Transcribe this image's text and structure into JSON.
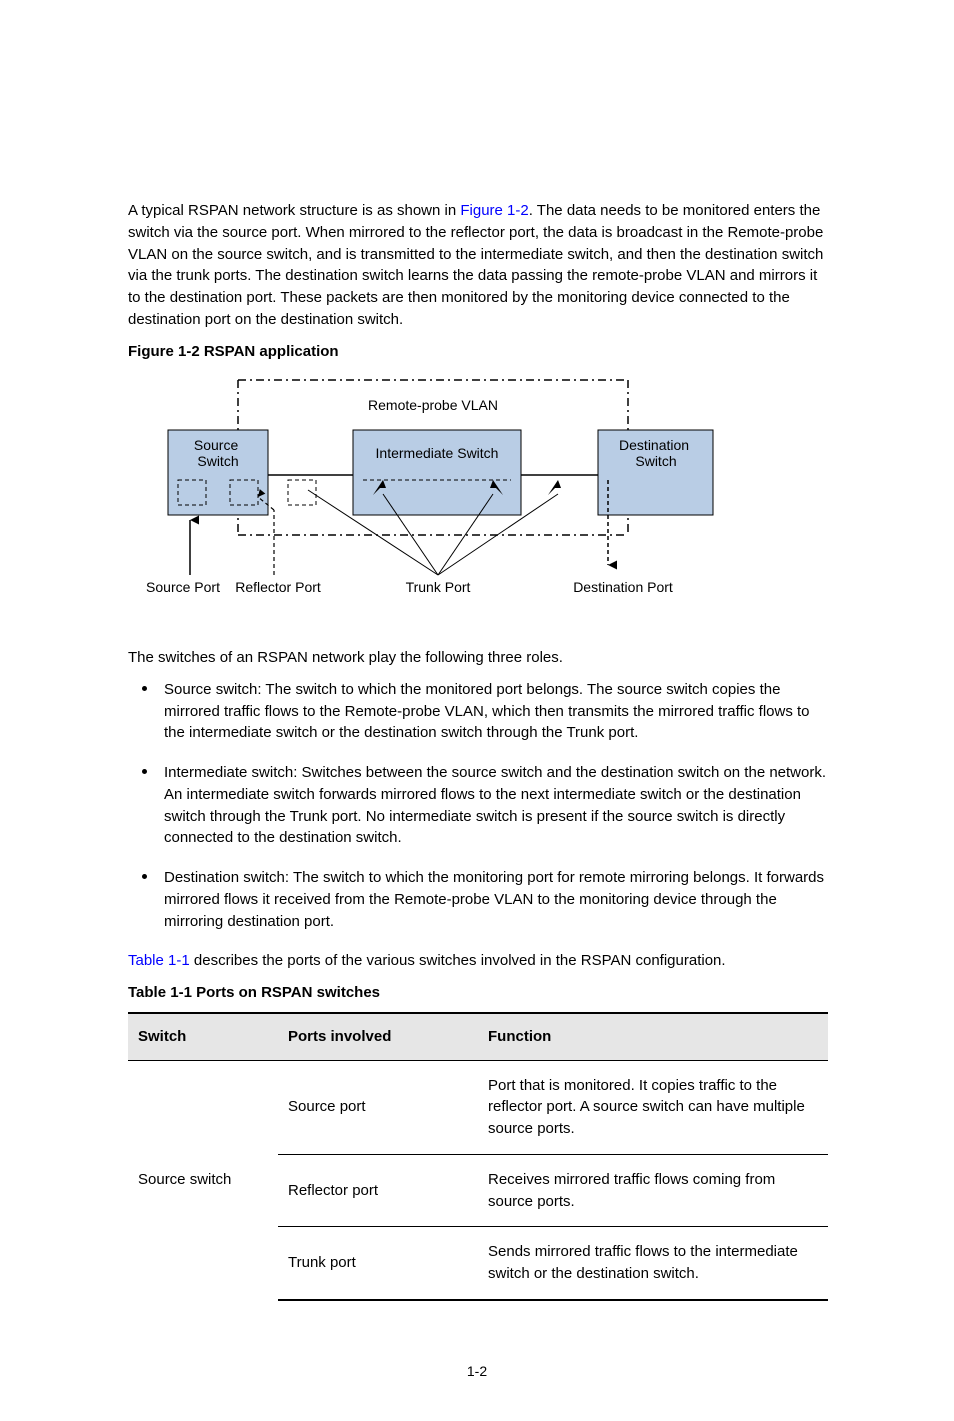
{
  "intro": {
    "p1_pre": "A typical RSPAN network structure is as shown in ",
    "figref": "Figure 1-2",
    "p1_post": ". The data needs to be monitored enters the switch via the source port. When mirrored to the reflector port, the data is broadcast in the Remote-probe VLAN on the source switch, and is transmitted to the intermediate switch, and then the destination switch via the trunk ports. The destination switch learns the data passing the remote-probe VLAN and mirrors it to the destination port. These packets are then monitored by the monitoring device connected to the destination port on the destination switch."
  },
  "figure": {
    "caption": "Figure 1-2 RSPAN application",
    "labels": {
      "remote_probe_vlan": "Remote-probe VLAN",
      "source_switch": "Source Switch",
      "intermediate_switch": "Intermediate Switch",
      "destination_switch": "Destination Switch",
      "source_port": "Source Port",
      "reflector_port": "Reflector Port",
      "trunk_port": "Trunk Port",
      "destination_port": "Destination Port"
    }
  },
  "roles": {
    "lead": "The switches of an RSPAN network play the following three roles.",
    "items": [
      "Source switch: The switch to which the monitored port belongs. The source switch copies the mirrored traffic flows to the Remote-probe VLAN, which then transmits the mirrored traffic flows to the intermediate switch or the destination switch through the Trunk port.",
      "Intermediate switch: Switches between the source switch and the destination switch on the network. An intermediate switch forwards mirrored flows to the next intermediate switch or the destination switch through the Trunk port. No intermediate switch is present if the source switch is directly connected to the destination switch.",
      "Destination switch: The switch to which the monitoring port for remote mirroring belongs. It forwards mirrored flows it received from the Remote-probe VLAN to the monitoring device through the mirroring destination port."
    ]
  },
  "table": {
    "lead_pre": "",
    "lead_ref": "Table 1-1",
    "lead_post": " describes the ports of the various switches involved in the RSPAN configuration.",
    "caption": "Table 1-1 Ports on RSPAN switches",
    "headers": [
      "Switch",
      "Ports involved",
      "Function"
    ],
    "rows": [
      [
        "Source switch",
        "Source port",
        "Port that is monitored. It copies traffic to the reflector port. A source switch can have multiple source ports."
      ],
      [
        "",
        "Reflector port",
        "Receives mirrored traffic flows coming from source ports."
      ],
      [
        "",
        "Trunk port",
        "Sends mirrored traffic flows to the intermediate switch or the destination switch."
      ]
    ]
  },
  "page_number": "1-2"
}
